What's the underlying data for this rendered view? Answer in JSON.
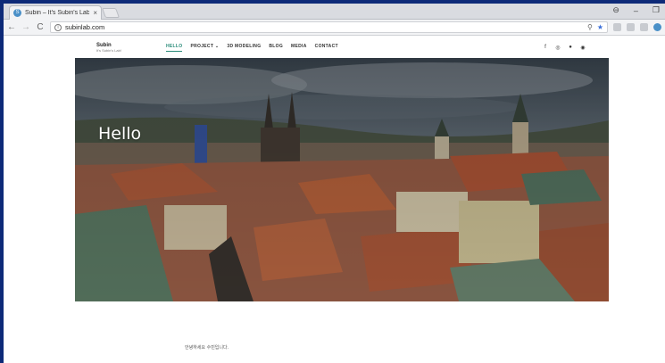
{
  "browser": {
    "tab_title": "Subin – It's Subin's Lab!",
    "tab_close": "×",
    "url": "subinlab.com",
    "window_controls": [
      "⊖",
      "–",
      "❐"
    ],
    "nav": {
      "back": "←",
      "forward": "→",
      "reload": "C"
    }
  },
  "site": {
    "brand_name": "Subin",
    "brand_tagline": "It's Subin's Lab!",
    "menu": [
      {
        "label": "HELLO",
        "active": true
      },
      {
        "label": "PROJECT ⌄",
        "active": false
      },
      {
        "label": "3D MODELING",
        "active": false
      },
      {
        "label": "BLOG",
        "active": false
      },
      {
        "label": "MEDIA",
        "active": false
      },
      {
        "label": "CONTACT",
        "active": false
      }
    ],
    "socials": [
      {
        "icon": "facebook-icon",
        "glyph": "f"
      },
      {
        "icon": "instagram-icon",
        "glyph": "◎"
      },
      {
        "icon": "github-icon",
        "glyph": "●"
      },
      {
        "icon": "dribbble-icon",
        "glyph": "◉"
      }
    ]
  },
  "hero": {
    "title": "Hello"
  },
  "intro_text": "안녕하세요 수빈입니다."
}
